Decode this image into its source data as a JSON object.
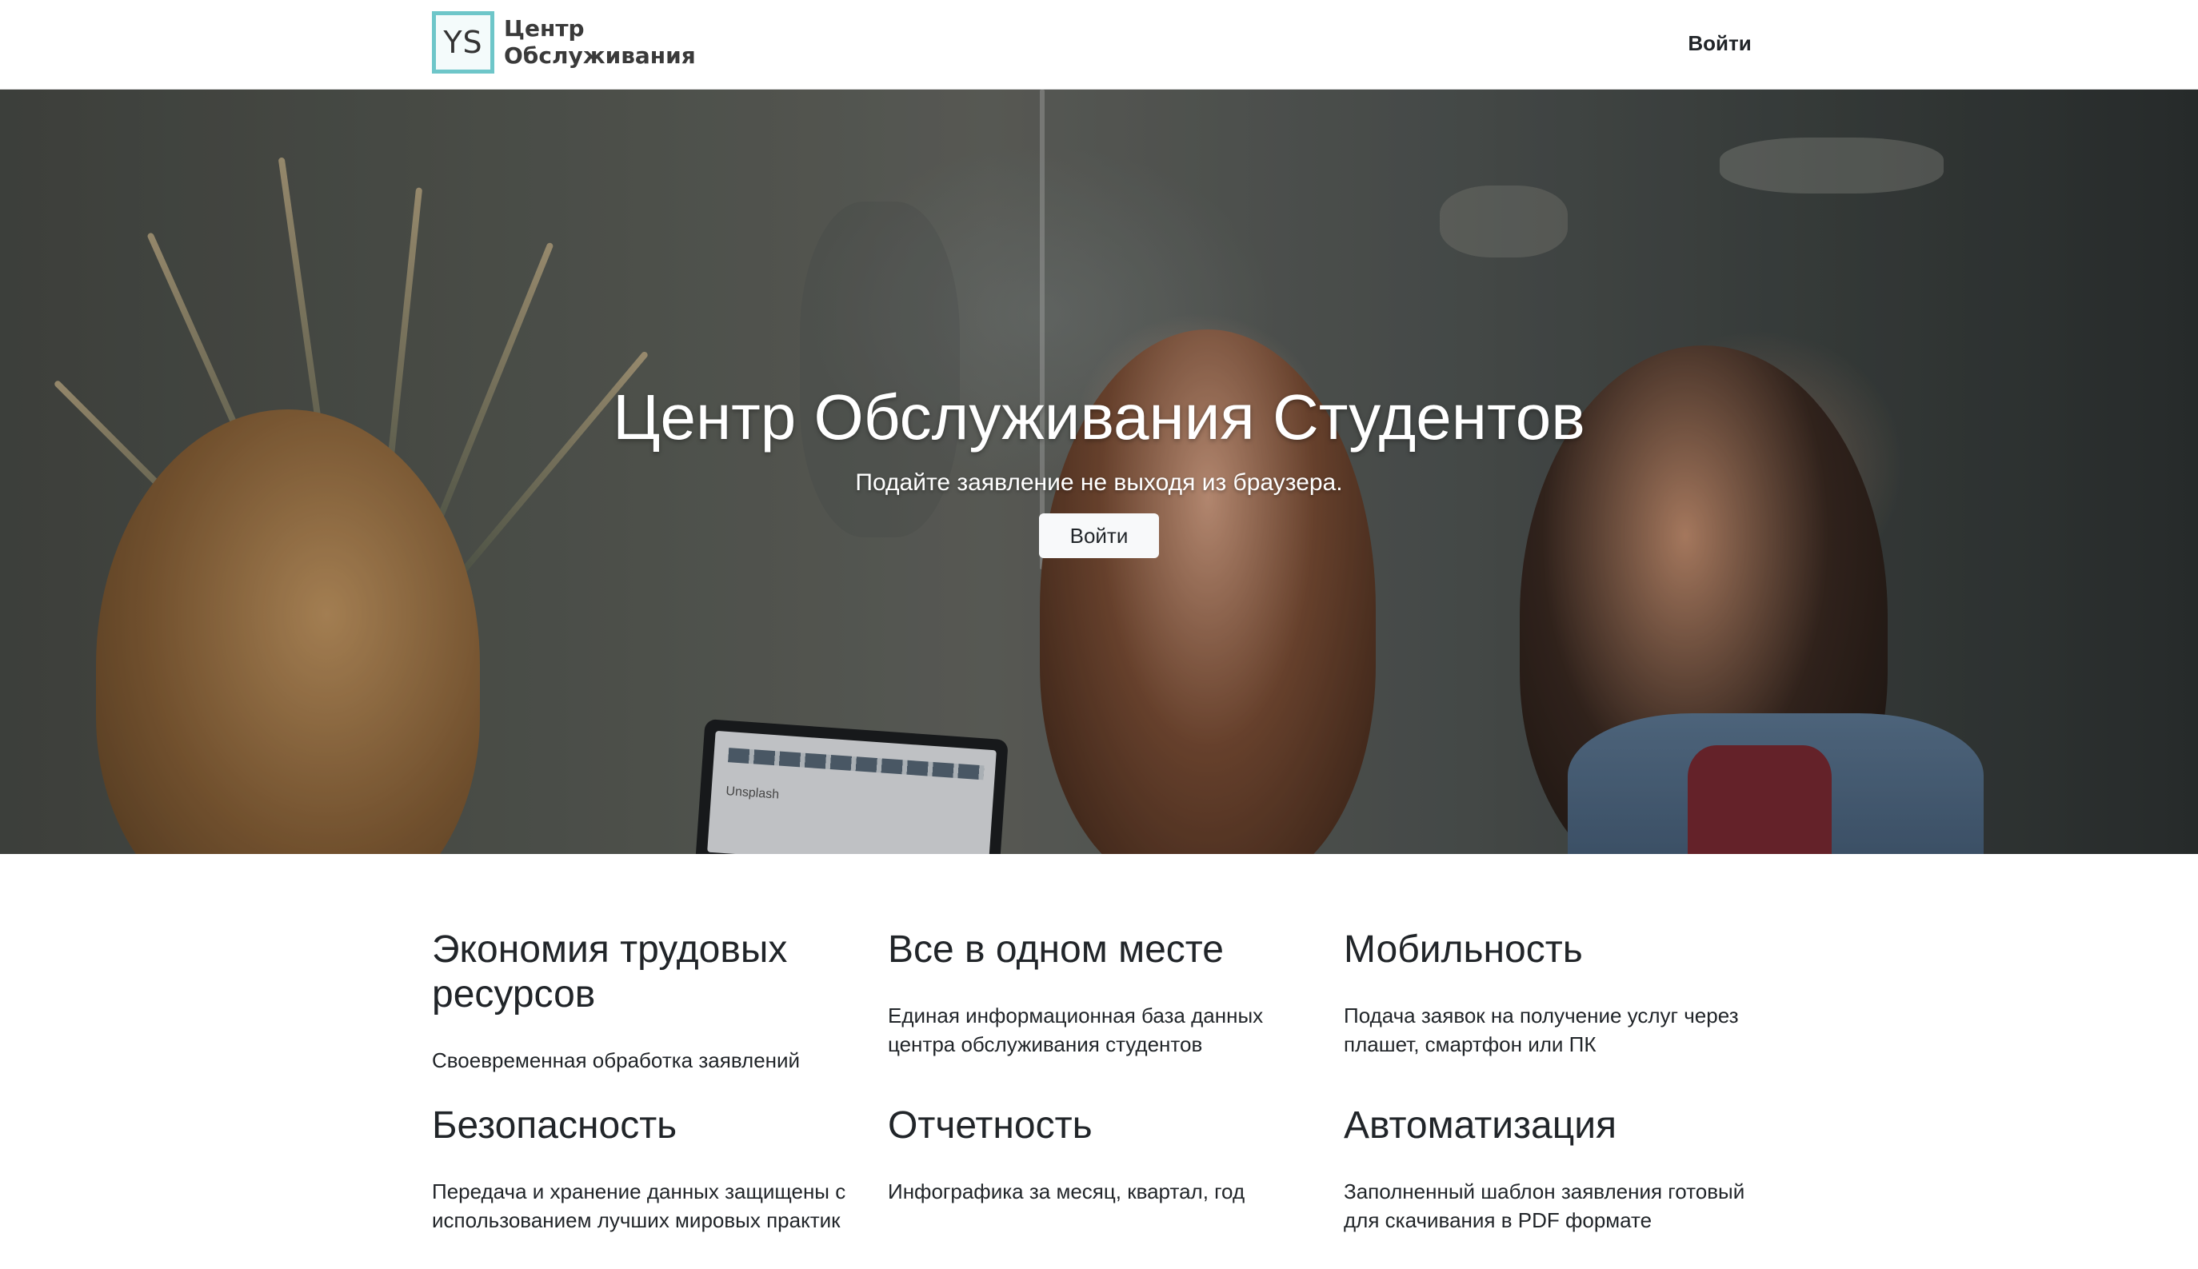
{
  "header": {
    "logo_initials": "YS",
    "brand_line1": "Центр",
    "brand_line2": "Обслуживания",
    "login_label": "Войти"
  },
  "hero": {
    "title": "Центр Обслуживания Студентов",
    "subtitle": "Подайте заявление не выходя из браузера.",
    "button_label": "Войти",
    "laptop_screen_text": "Unsplash"
  },
  "features": [
    {
      "title": "Экономия трудовых ресурсов",
      "text": "Своевременная обработка заявлений"
    },
    {
      "title": "Все в одном месте",
      "text": "Единая информационная база данных центра обслуживания студентов"
    },
    {
      "title": "Мобильность",
      "text": "Подача заявок на получение услуг через плашет, смартфон или ПК"
    },
    {
      "title": "Безопасность",
      "text": "Передача и хранение данных защищены с использованием лучших мировых практик"
    },
    {
      "title": "Отчетность",
      "text": "Инфографика за месяц, квартал, год"
    },
    {
      "title": "Автоматизация",
      "text": "Заполненный шаблон заявления готовый для скачивания в PDF формате"
    }
  ],
  "colors": {
    "logo_border": "#6ec6c9",
    "text": "#212529",
    "hero_button_bg": "#f8f9fa"
  }
}
